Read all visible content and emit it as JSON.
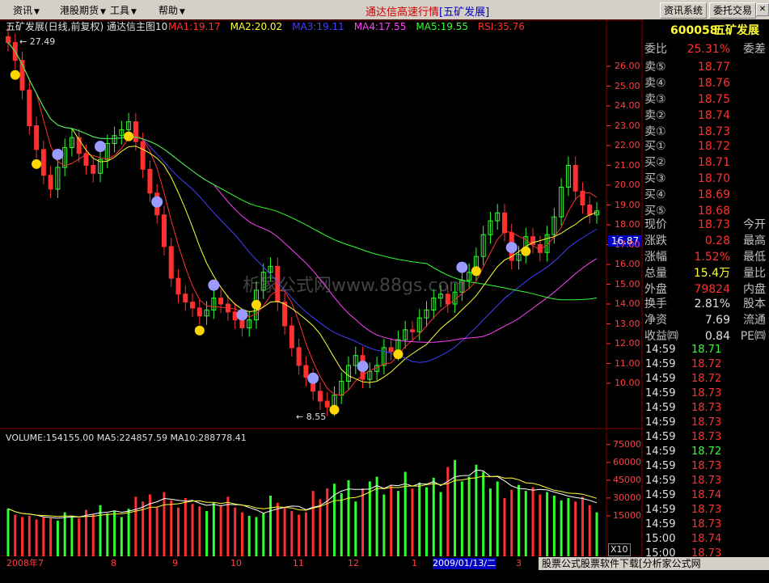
{
  "menu": {
    "items": [
      "资讯",
      "港股期货",
      "工具",
      "帮助"
    ],
    "title": "通达信高速行情",
    "title_stock": "[五矿发展]",
    "buttons": {
      "news": "资讯系统",
      "trade": "委托交易"
    }
  },
  "chart": {
    "header": "五矿发展(日线,前复权) 通达信主图10",
    "ma": [
      {
        "label": "MA1:19.17",
        "color": "#ff3030"
      },
      {
        "label": "MA2:20.02",
        "color": "#ffff30"
      },
      {
        "label": "MA3:19.11",
        "color": "#4040ff"
      },
      {
        "label": "MA4:17.55",
        "color": "#ff40ff"
      },
      {
        "label": "MA5:19.55",
        "color": "#30ff30"
      },
      {
        "label": "RSI:35.76",
        "color": "#ff3030"
      }
    ],
    "high_label": "27.49",
    "low_label": "8.55",
    "current_tag": "16.87",
    "watermark": "析家公式网www.88gs.com",
    "volume_header": {
      "volume": "VOLUME:154155.00",
      "ma5": "MA5:224857.59",
      "ma10": "MA10:288778.41"
    },
    "x_labels": [
      "2008年7",
      "8",
      "9",
      "10",
      "11",
      "12",
      "1",
      "2009/01/13/二",
      "3"
    ],
    "x10": "X10"
  },
  "chart_data": {
    "type": "candlestick",
    "price_axis": {
      "ticks": [
        "26.00",
        "25.00",
        "24.00",
        "23.00",
        "22.00",
        "21.00",
        "20.00",
        "19.00",
        "18.00",
        "17.00",
        "16.00",
        "15.00",
        "14.00",
        "13.00",
        "12.00",
        "11.00",
        "10.00"
      ]
    },
    "volume_axis": {
      "ticks": [
        "75000",
        "60000",
        "45000",
        "30000",
        "15000"
      ]
    },
    "close_approx": [
      27.2,
      26.3,
      24.8,
      23.0,
      21.8,
      20.5,
      19.8,
      20.9,
      21.9,
      22.4,
      21.6,
      21.0,
      20.6,
      21.3,
      22.1,
      22.5,
      22.8,
      23.2,
      22.2,
      20.8,
      19.6,
      18.5,
      16.9,
      15.3,
      14.5,
      14.1,
      13.8,
      13.4,
      13.7,
      14.3,
      14.0,
      13.6,
      13.2,
      12.8,
      13.2,
      14.7,
      15.6,
      15.9,
      14.1,
      12.9,
      11.8,
      10.9,
      10.3,
      9.6,
      9.1,
      8.8,
      9.4,
      10.1,
      10.9,
      11.4,
      10.2,
      10.6,
      10.9,
      11.8,
      11.6,
      12.2,
      12.7,
      12.6,
      13.3,
      13.7,
      14.3,
      14.5,
      14.0,
      14.6,
      15.2,
      15.6,
      16.4,
      17.5,
      18.2,
      18.6,
      17.6,
      16.2,
      16.5,
      17.4,
      17.0,
      16.6,
      17.5,
      18.4,
      19.9,
      21.0,
      19.7,
      19.0,
      18.5,
      18.7
    ],
    "volume_approx": [
      21000,
      16000,
      14000,
      15000,
      12000,
      14000,
      13000,
      11000,
      18000,
      15000,
      13000,
      20000,
      16000,
      24000,
      17000,
      19000,
      14000,
      21000,
      31000,
      27000,
      33000,
      22000,
      35000,
      28000,
      22000,
      30000,
      25000,
      23000,
      19000,
      26000,
      24000,
      31000,
      22000,
      18000,
      15000,
      14000,
      17000,
      32000,
      26000,
      22000,
      19000,
      16000,
      18000,
      36000,
      29000,
      38000,
      42000,
      34000,
      45000,
      27000,
      38000,
      44000,
      48000,
      33000,
      41000,
      36000,
      52000,
      38000,
      43000,
      39000,
      47000,
      35000,
      56000,
      62000,
      44000,
      48000,
      58000,
      52000,
      38000,
      44000,
      30000,
      37000,
      41000,
      36000,
      39000,
      33000,
      35000,
      32000,
      28000,
      30000,
      27000,
      31000,
      24000,
      18000
    ]
  },
  "panel": {
    "code": "600058",
    "name": "五矿发展",
    "ratio": {
      "label": "委比",
      "value": "25.31%",
      "label2": "委差"
    },
    "sells": [
      {
        "label": "卖⑤",
        "value": "18.77"
      },
      {
        "label": "卖④",
        "value": "18.76"
      },
      {
        "label": "卖③",
        "value": "18.75"
      },
      {
        "label": "卖②",
        "value": "18.74"
      },
      {
        "label": "卖①",
        "value": "18.73"
      }
    ],
    "buys": [
      {
        "label": "买①",
        "value": "18.72"
      },
      {
        "label": "买②",
        "value": "18.71"
      },
      {
        "label": "买③",
        "value": "18.70"
      },
      {
        "label": "买④",
        "value": "18.69"
      },
      {
        "label": "买⑤",
        "value": "18.68"
      }
    ],
    "stats1": [
      {
        "label": "现价",
        "value": "18.73",
        "label2": "今开",
        "color": "#ff3030"
      },
      {
        "label": "涨跌",
        "value": "0.28",
        "label2": "最高",
        "color": "#ff3030"
      },
      {
        "label": "涨幅",
        "value": "1.52%",
        "label2": "最低",
        "color": "#ff3030"
      },
      {
        "label": "总量",
        "value": "15.4万",
        "label2": "量比",
        "color": "#ffff30"
      },
      {
        "label": "外盘",
        "value": "79824",
        "label2": "内盘",
        "color": "#ff3030"
      }
    ],
    "stats2": [
      {
        "label": "换手",
        "value": "2.81%",
        "label2": "股本",
        "color": "#e0e0e0"
      },
      {
        "label": "净资",
        "value": "7.69",
        "label2": "流通",
        "color": "#e0e0e0"
      },
      {
        "label": "收益㈣",
        "value": "0.84",
        "label2": "PE㈣",
        "color": "#e0e0e0"
      }
    ],
    "ticks": [
      {
        "time": "14:59",
        "price": "18.71",
        "color": "#30ff30"
      },
      {
        "time": "14:59",
        "price": "18.72",
        "color": "#ff3030"
      },
      {
        "time": "14:59",
        "price": "18.72",
        "color": "#ff3030"
      },
      {
        "time": "14:59",
        "price": "18.73",
        "color": "#ff3030"
      },
      {
        "time": "14:59",
        "price": "18.73",
        "color": "#ff3030"
      },
      {
        "time": "14:59",
        "price": "18.73",
        "color": "#ff3030"
      },
      {
        "time": "14:59",
        "price": "18.73",
        "color": "#ff3030"
      },
      {
        "time": "14:59",
        "price": "18.72",
        "color": "#30ff30"
      },
      {
        "time": "14:59",
        "price": "18.73",
        "color": "#ff3030"
      },
      {
        "time": "14:59",
        "price": "18.73",
        "color": "#ff3030"
      },
      {
        "time": "14:59",
        "price": "18.74",
        "color": "#ff3030"
      },
      {
        "time": "14:59",
        "price": "18.73",
        "color": "#ff3030"
      },
      {
        "time": "14:59",
        "price": "18.73",
        "color": "#ff3030"
      },
      {
        "time": "15:00",
        "price": "18.74",
        "color": "#ff3030"
      },
      {
        "time": "15:00",
        "price": "18.73",
        "color": "#ff3030"
      }
    ]
  },
  "footer": "股票公式股票软件下载[分析家公式网www.88gs.com]"
}
